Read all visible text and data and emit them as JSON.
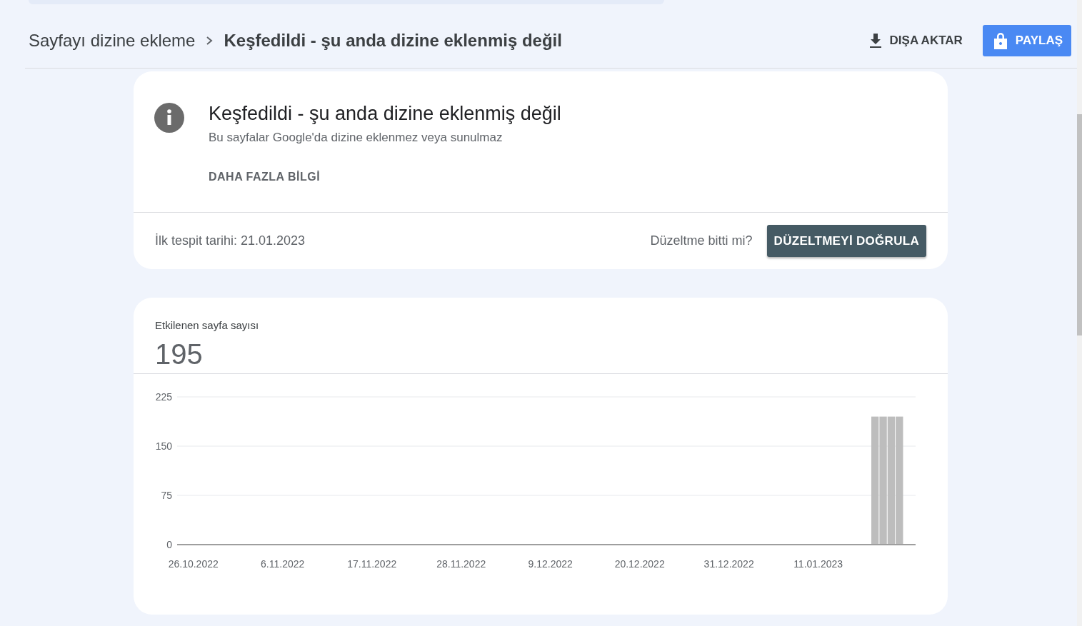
{
  "breadcrumb": [
    {
      "label": "Sayfayı dizine ekleme"
    },
    {
      "label": "Keşfedildi - şu anda dizine eklenmiş değil"
    }
  ],
  "actions": [
    {
      "kind": "export",
      "label": "DIŞA AKTAR"
    },
    {
      "kind": "share",
      "label": "PAYLAŞ"
    }
  ],
  "issue": {
    "title": "Keşfedildi - şu anda dizine eklenmiş değil",
    "description": "Bu sayfalar Google'da dizine eklenmez veya sunulmaz",
    "learn_more": "DAHA FAZLA BİLGİ",
    "first_detected": "İlk tespit tarihi: 21.01.2023",
    "fix_prompt": "Düzeltme bitti mi?",
    "validate_button": "DÜZELTMEYİ DOĞRULA"
  },
  "affected": {
    "label": "Etkilenen sayfa sayısı",
    "count": "195",
    "chart_data": {
      "type": "bar",
      "ylim": [
        0,
        225
      ],
      "yticks": [
        0,
        75,
        150,
        225
      ],
      "categories": [
        "26.10.2022",
        null,
        null,
        null,
        null,
        null,
        null,
        null,
        null,
        null,
        null,
        "6.11.2022",
        null,
        null,
        null,
        null,
        null,
        null,
        null,
        null,
        null,
        null,
        "17.11.2022",
        null,
        null,
        null,
        null,
        null,
        null,
        null,
        null,
        null,
        null,
        "28.11.2022",
        null,
        null,
        null,
        null,
        null,
        null,
        null,
        null,
        null,
        null,
        "9.12.2022",
        null,
        null,
        null,
        null,
        null,
        null,
        null,
        null,
        null,
        null,
        "20.12.2022",
        null,
        null,
        null,
        null,
        null,
        null,
        null,
        null,
        null,
        null,
        "31.12.2022",
        null,
        null,
        null,
        null,
        null,
        null,
        null,
        null,
        null,
        null,
        "11.01.2023",
        null,
        null,
        null,
        null,
        null,
        null,
        null,
        null,
        null,
        null
      ],
      "values": [
        null,
        null,
        null,
        null,
        null,
        null,
        null,
        null,
        null,
        null,
        null,
        null,
        null,
        null,
        null,
        null,
        null,
        null,
        null,
        null,
        null,
        null,
        null,
        null,
        null,
        null,
        null,
        null,
        null,
        null,
        null,
        null,
        null,
        null,
        null,
        null,
        null,
        null,
        null,
        null,
        null,
        null,
        null,
        null,
        null,
        null,
        null,
        null,
        null,
        null,
        null,
        null,
        null,
        null,
        null,
        null,
        null,
        null,
        null,
        null,
        null,
        null,
        null,
        null,
        null,
        null,
        null,
        null,
        null,
        null,
        null,
        null,
        null,
        null,
        null,
        null,
        null,
        null,
        null,
        null,
        null,
        null,
        null,
        null,
        195,
        195,
        195,
        195
      ]
    }
  }
}
